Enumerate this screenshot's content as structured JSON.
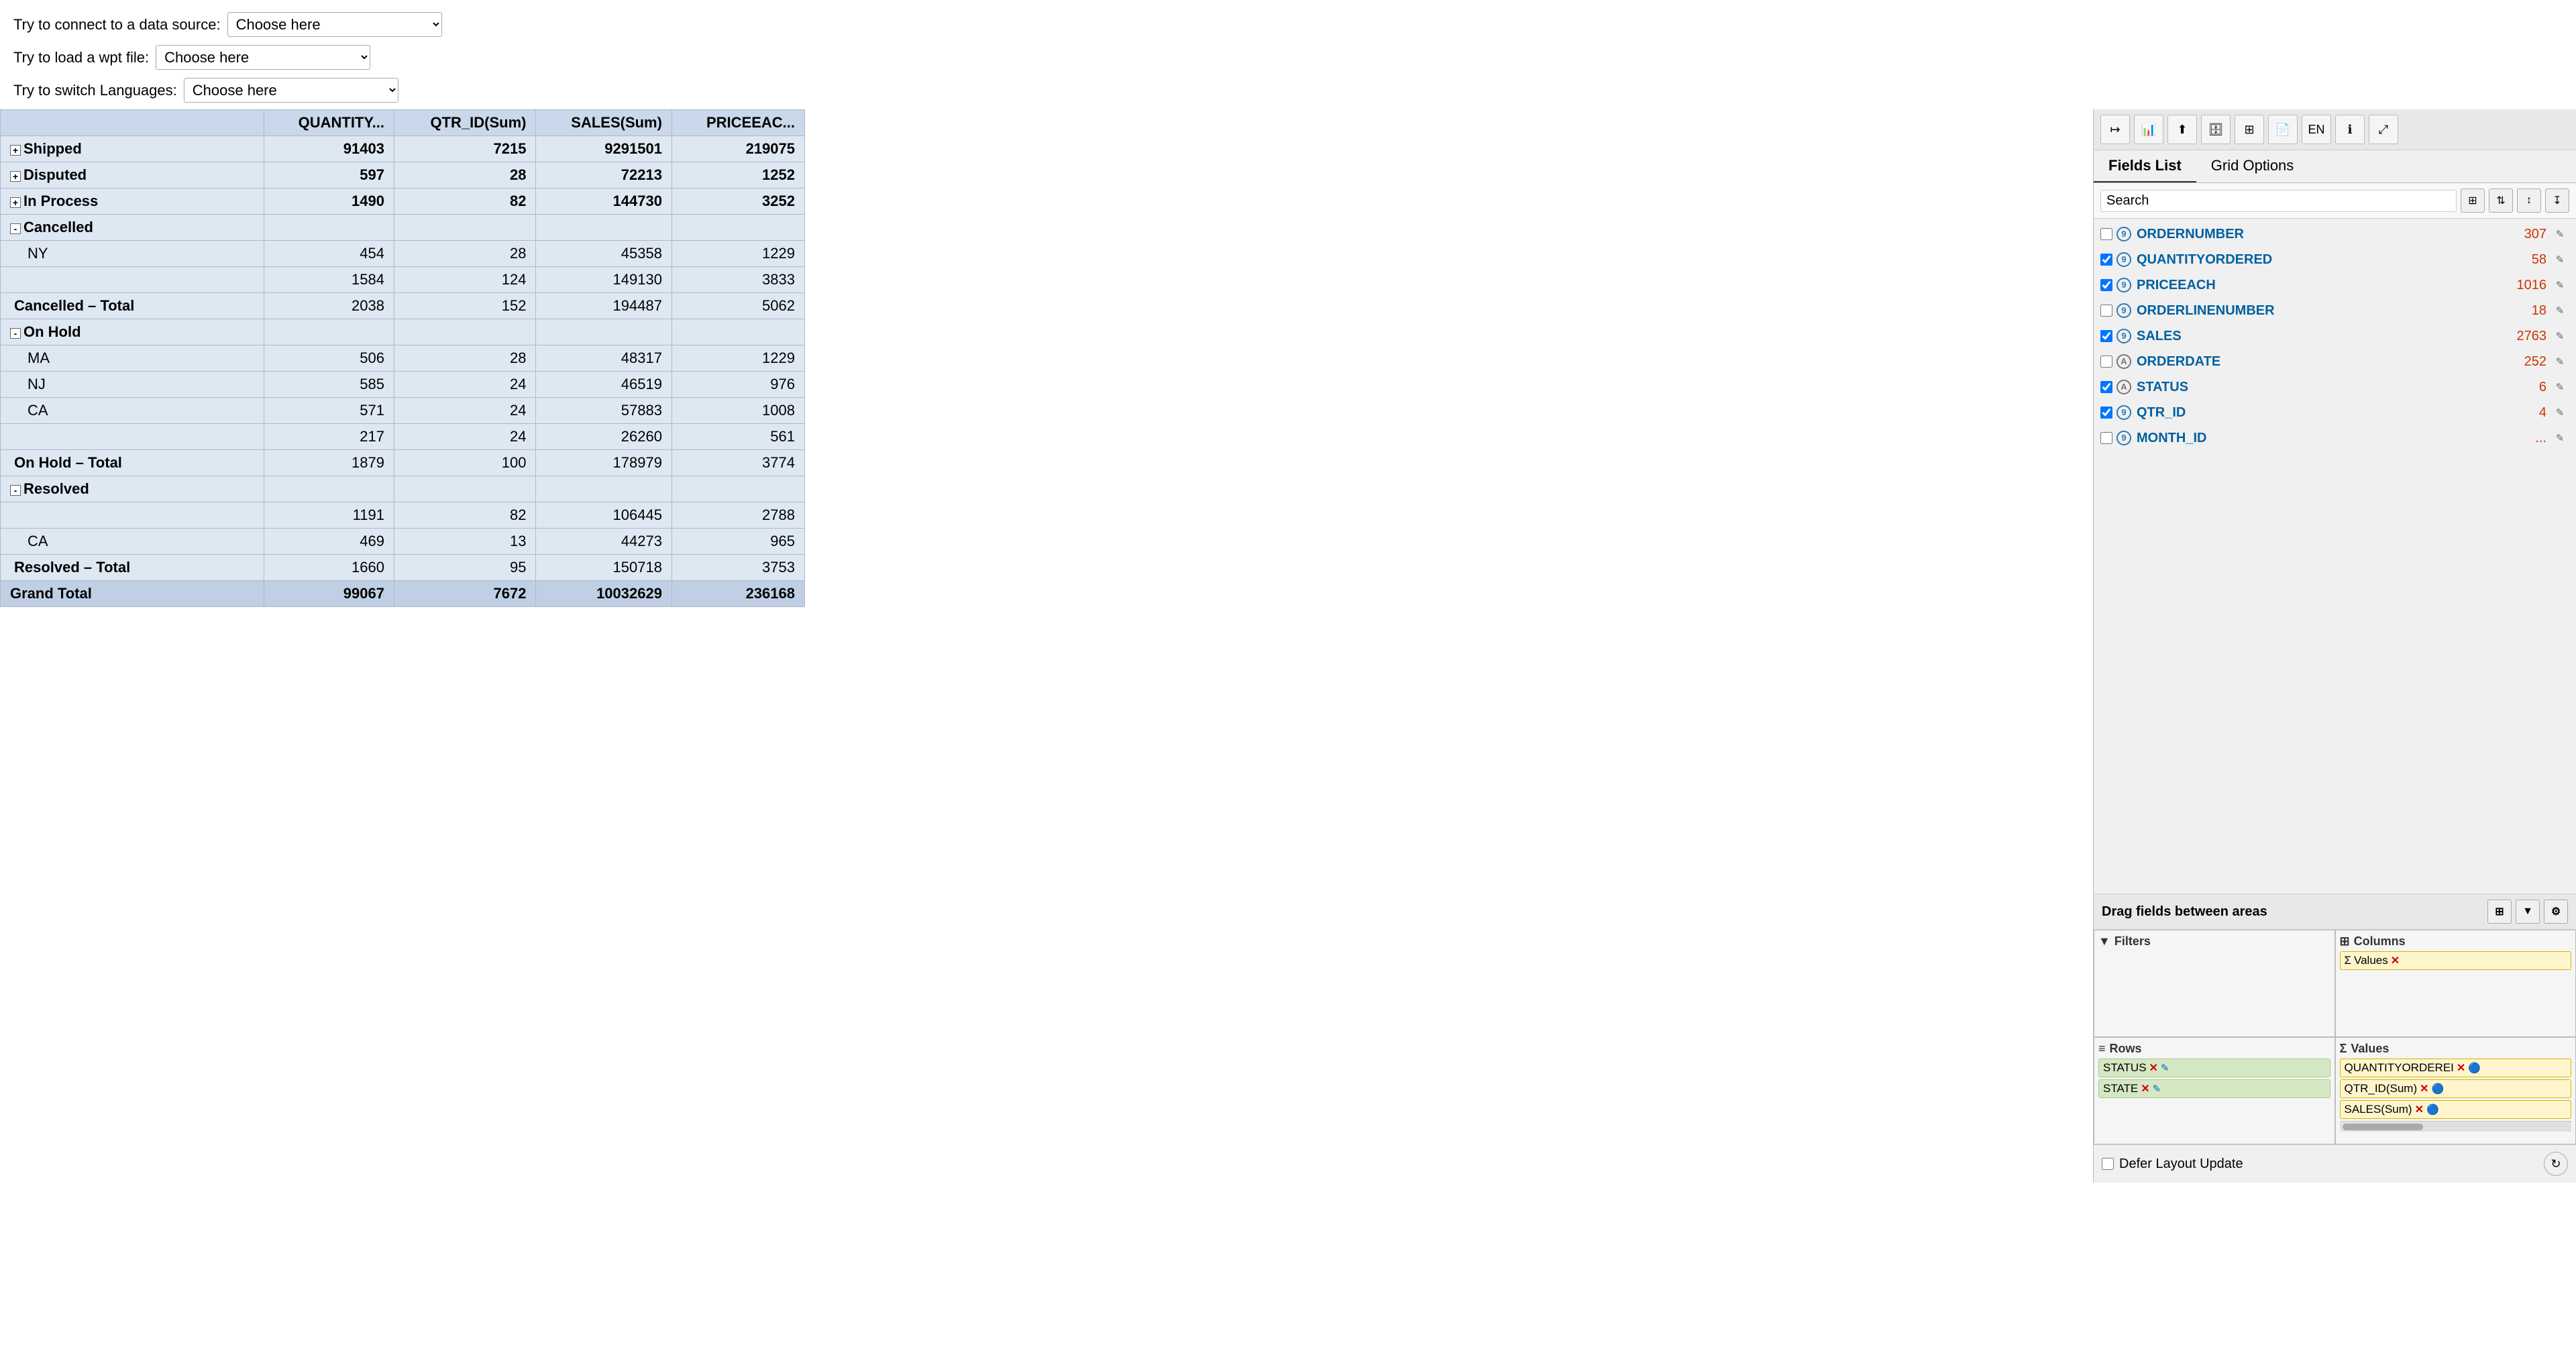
{
  "top_controls": {
    "connect_label": "Try to connect to a data source:",
    "connect_placeholder": "Choose here",
    "wpt_label": "Try to load a wpt file:",
    "wpt_placeholder": "Choose here",
    "language_label": "Try to switch Languages:",
    "language_placeholder": "Choose here"
  },
  "pivot": {
    "columns": [
      "",
      "QUANTITY...",
      "QTR_ID(Sum)",
      "SALES(Sum)",
      "PRICEEAC..."
    ],
    "rows": [
      {
        "type": "group",
        "label": "Shipped",
        "expand": "+",
        "values": [
          "",
          "91403",
          "7215",
          "9291501",
          "219075"
        ]
      },
      {
        "type": "group",
        "label": "Disputed",
        "expand": "+",
        "values": [
          "",
          "597",
          "28",
          "72213",
          "1252"
        ]
      },
      {
        "type": "group",
        "label": "In Process",
        "expand": "+",
        "values": [
          "",
          "1490",
          "82",
          "144730",
          "3252"
        ]
      },
      {
        "type": "group-open",
        "label": "Cancelled",
        "expand": "-",
        "values": [
          "",
          "",
          "",
          "",
          ""
        ]
      },
      {
        "type": "subitem",
        "label": "NY",
        "values": [
          "",
          "454",
          "28",
          "45358",
          "1229"
        ]
      },
      {
        "type": "subitem",
        "label": "",
        "values": [
          "",
          "1584",
          "124",
          "149130",
          "3833"
        ]
      },
      {
        "type": "subtotal",
        "label": "Cancelled – Total",
        "values": [
          "",
          "2038",
          "152",
          "194487",
          "5062"
        ]
      },
      {
        "type": "group-open",
        "label": "On Hold",
        "expand": "-",
        "values": [
          "",
          "",
          "",
          "",
          ""
        ]
      },
      {
        "type": "subitem",
        "label": "MA",
        "values": [
          "",
          "506",
          "28",
          "48317",
          "1229"
        ]
      },
      {
        "type": "subitem",
        "label": "NJ",
        "values": [
          "",
          "585",
          "24",
          "46519",
          "976"
        ]
      },
      {
        "type": "subitem",
        "label": "CA",
        "values": [
          "",
          "571",
          "24",
          "57883",
          "1008"
        ]
      },
      {
        "type": "subitem",
        "label": "",
        "values": [
          "",
          "217",
          "24",
          "26260",
          "561"
        ]
      },
      {
        "type": "subtotal",
        "label": "On Hold – Total",
        "values": [
          "",
          "1879",
          "100",
          "178979",
          "3774"
        ]
      },
      {
        "type": "group-open",
        "label": "Resolved",
        "expand": "-",
        "values": [
          "",
          "",
          "",
          "",
          ""
        ]
      },
      {
        "type": "subitem",
        "label": "",
        "values": [
          "",
          "1191",
          "82",
          "106445",
          "2788"
        ]
      },
      {
        "type": "subitem",
        "label": "CA",
        "values": [
          "",
          "469",
          "13",
          "44273",
          "965"
        ]
      },
      {
        "type": "subtotal",
        "label": "Resolved – Total",
        "values": [
          "",
          "1660",
          "95",
          "150718",
          "3753"
        ]
      },
      {
        "type": "grandtotal",
        "label": "Grand Total",
        "values": [
          "",
          "99067",
          "7672",
          "10032629",
          "236168"
        ]
      }
    ]
  },
  "panel": {
    "toolbar_buttons": [
      "pin-icon",
      "chart-icon",
      "upload-icon",
      "database-icon",
      "table-icon",
      "page-icon",
      "lang-icon",
      "info-icon",
      "expand-icon"
    ],
    "toolbar_labels": [
      "↦",
      "📊",
      "⬆",
      "🗄",
      "⊞",
      "📄",
      "EN",
      "ℹ",
      "⤢"
    ],
    "tabs": [
      "Fields List",
      "Grid Options"
    ],
    "search_placeholder": "Search",
    "sort_icons": [
      "sort-az",
      "sort-za",
      "sort-num"
    ],
    "fields": [
      {
        "checked": false,
        "badge": "9",
        "badge_type": "num",
        "name": "ORDERNUMBER",
        "count": "307"
      },
      {
        "checked": true,
        "badge": "9",
        "badge_type": "num",
        "name": "QUANTITYORDERED",
        "count": "58"
      },
      {
        "checked": true,
        "badge": "9",
        "badge_type": "num",
        "name": "PRICEEACH",
        "count": "1016"
      },
      {
        "checked": false,
        "badge": "9",
        "badge_type": "num",
        "name": "ORDERLINENUMBER",
        "count": "18"
      },
      {
        "checked": true,
        "badge": "9",
        "badge_type": "num",
        "name": "SALES",
        "count": "2763"
      },
      {
        "checked": false,
        "badge": "A",
        "badge_type": "alpha",
        "name": "ORDERDATE",
        "count": "252"
      },
      {
        "checked": true,
        "badge": "A",
        "badge_type": "alpha",
        "name": "STATUS",
        "count": "6"
      },
      {
        "checked": true,
        "badge": "9",
        "badge_type": "num",
        "name": "QTR_ID",
        "count": "4"
      },
      {
        "checked": false,
        "badge": "9",
        "badge_type": "num",
        "name": "MONTH_ID",
        "count": "..."
      }
    ],
    "drag_label": "Drag fields between areas",
    "drag_icons": [
      "filter-icon",
      "funnel-icon",
      "settings-icon"
    ],
    "filters_label": "Filters",
    "columns_label": "Columns",
    "values_label_col": "Values",
    "values_label_row": "Values",
    "rows_label": "Rows",
    "rows_chips": [
      {
        "name": "STATUS",
        "type": "row"
      },
      {
        "name": "STATE",
        "type": "row"
      }
    ],
    "values_chips": [
      {
        "name": "QUANTITYORDEREI",
        "type": "value"
      },
      {
        "name": "QTR_ID(Sum)",
        "type": "value"
      },
      {
        "name": "SALES(Sum)",
        "type": "value"
      }
    ],
    "defer_label": "Defer Layout Update"
  }
}
